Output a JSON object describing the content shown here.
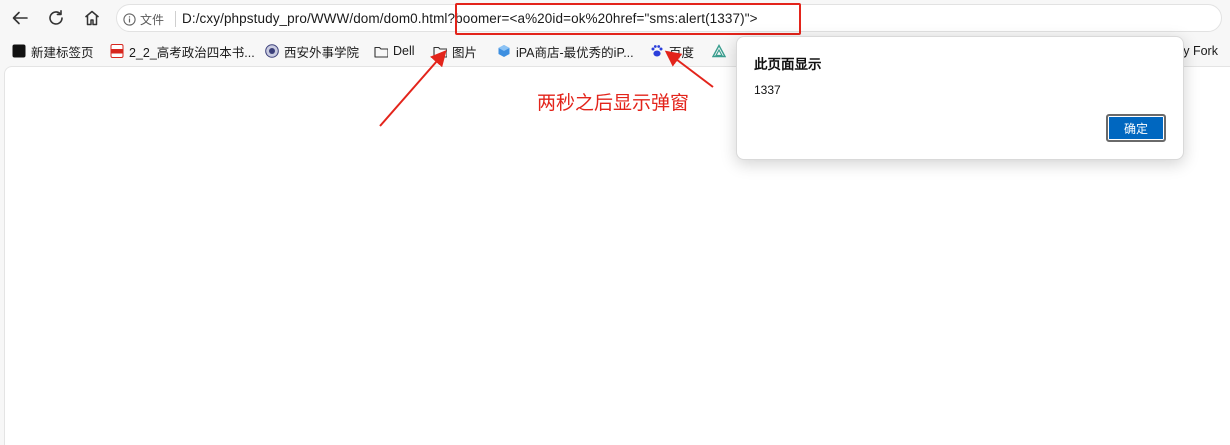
{
  "browser": {
    "site_info_label": "文件",
    "url": "D:/cxy/phpstudy_pro/WWW/dom/dom0.html?boomer=<a%20id=ok%20href=\"sms:alert(1337)\">",
    "nav_icons": [
      "back-arrow-icon",
      "refresh-icon",
      "home-icon"
    ]
  },
  "bookmarks": [
    {
      "label": "新建标签页",
      "icon": "new-tab-icon"
    },
    {
      "label": "2_2_高考政治四本书...",
      "icon": "pdf-icon"
    },
    {
      "label": "西安外事学院",
      "icon": "school-emblem-icon"
    },
    {
      "label": "Dell",
      "icon": "folder-icon"
    },
    {
      "label": "图片",
      "icon": "folder-icon"
    },
    {
      "label": "iPA商店-最优秀的iP...",
      "icon": "cube-icon"
    },
    {
      "label": "百度",
      "icon": "baidu-paw-icon"
    },
    {
      "label": "sy Fork",
      "icon": ""
    }
  ],
  "dialog": {
    "title": "此页面显示",
    "message": "1337",
    "ok_label": "确定"
  },
  "annotation": {
    "text": "两秒之后显示弹窗",
    "color": "#e3241b"
  },
  "colors": {
    "dialog_button": "#0067c0",
    "highlight": "#e3241b"
  }
}
